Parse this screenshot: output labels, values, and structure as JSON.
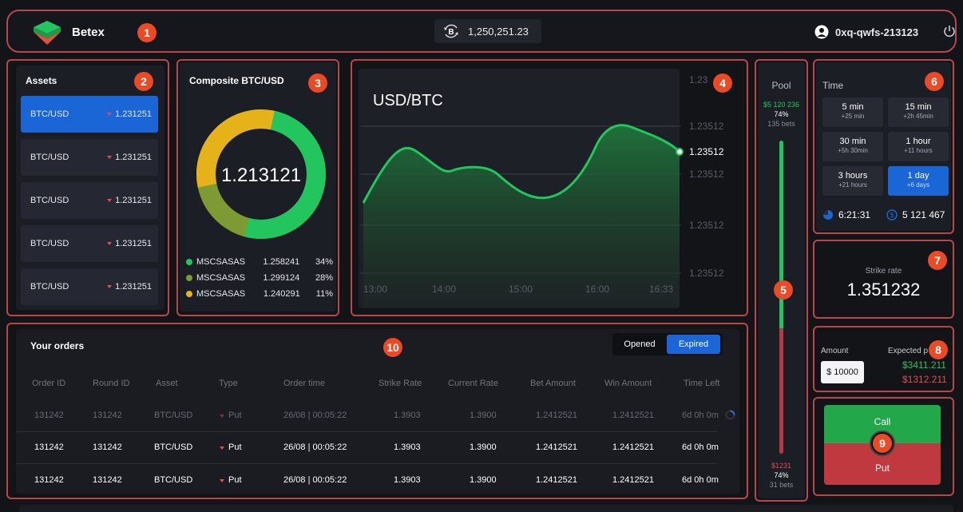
{
  "header": {
    "brand": "Betex",
    "balance": "1,250,251.23",
    "wallet_id": "0xq-qwfs-213123"
  },
  "badges": [
    "1",
    "2",
    "3",
    "4",
    "5",
    "6",
    "7",
    "8",
    "9",
    "10"
  ],
  "assets": {
    "title": "Assets",
    "items": [
      {
        "name": "BTC/USD",
        "rate": "1.231251"
      },
      {
        "name": "BTC/USD",
        "rate": "1.231251"
      },
      {
        "name": "BTC/USD",
        "rate": "1.231251"
      },
      {
        "name": "BTC/USD",
        "rate": "1.231251"
      },
      {
        "name": "BTC/USD",
        "rate": "1.231251"
      }
    ]
  },
  "composite": {
    "title": "Composite BTC/USD",
    "center_value": "1.213121",
    "legend": [
      {
        "name": "MSCSASAS",
        "value": "1.258241",
        "pct": "34%",
        "color": "#22c55e"
      },
      {
        "name": "MSCSASAS",
        "value": "1.299124",
        "pct": "28%",
        "color": "#7d9a33"
      },
      {
        "name": "MSCSASAS",
        "value": "1.240291",
        "pct": "11%",
        "color": "#e6b21a"
      }
    ]
  },
  "chart": {
    "title": "USD/BTC",
    "current": "1.23512",
    "y_ticks": [
      "1.23",
      "1.23512",
      "1.23512",
      "1.23512",
      "1.23512"
    ],
    "x_ticks": [
      "13:00",
      "14:00",
      "15:00",
      "16:00",
      "16:33"
    ],
    "line_color": "#22c55e"
  },
  "pool": {
    "title": "Pool",
    "top_amount": "$5 120 236",
    "top_pct": "74%",
    "top_bets": "135 bets",
    "bottom_amount": "$1231",
    "bottom_pct": "74%",
    "bottom_bets": "31 bets",
    "green_fraction": 0.6
  },
  "time": {
    "title": "Time",
    "options": [
      {
        "label": "5 min",
        "sub": "+25 min"
      },
      {
        "label": "15 min",
        "sub": "+2h 45min"
      },
      {
        "label": "30 min",
        "sub": "+5h 30min"
      },
      {
        "label": "1 hour",
        "sub": "+11 hours"
      },
      {
        "label": "3 hours",
        "sub": "+21 hours"
      },
      {
        "label": "1 day",
        "sub": "+6 days"
      }
    ],
    "countdown": "6:21:31",
    "total": "5 121 467"
  },
  "strike": {
    "label": "Strike rate",
    "value": "1.351232"
  },
  "amount": {
    "label": "Amount",
    "value": "$ 10000",
    "expected_label": "Expected p",
    "expected_up": "$3411.211",
    "expected_down": "$1312.211"
  },
  "trade": {
    "call_label": "Call",
    "put_label": "Put"
  },
  "orders": {
    "title": "Your orders",
    "tab_opened": "Opened",
    "tab_expired": "Expired",
    "columns": [
      "Order ID",
      "Round ID",
      "Asset",
      "Type",
      "Order time",
      "Strike Rate",
      "Current Rate",
      "Bet Amount",
      "Win Amount",
      "Time Left"
    ],
    "rows": [
      {
        "order_id": "131242",
        "round_id": "131242",
        "asset": "BTC/USD",
        "type": "Put",
        "time": "26/08 | 00:05:22",
        "strike": "1.3903",
        "current": "1.3900",
        "bet": "1.2412521",
        "win": "1.2412521",
        "left": "6d 0h 0m"
      },
      {
        "order_id": "131242",
        "round_id": "131242",
        "asset": "BTC/USD",
        "type": "Put",
        "time": "26/08 | 00:05:22",
        "strike": "1.3903",
        "current": "1.3900",
        "bet": "1.2412521",
        "win": "1.2412521",
        "left": "6d 0h 0m"
      },
      {
        "order_id": "131242",
        "round_id": "131242",
        "asset": "BTC/USD",
        "type": "Put",
        "time": "26/08 | 00:05:22",
        "strike": "1.3903",
        "current": "1.3900",
        "bet": "1.2412521",
        "win": "1.2412521",
        "left": "6d 0h 0m"
      }
    ]
  }
}
